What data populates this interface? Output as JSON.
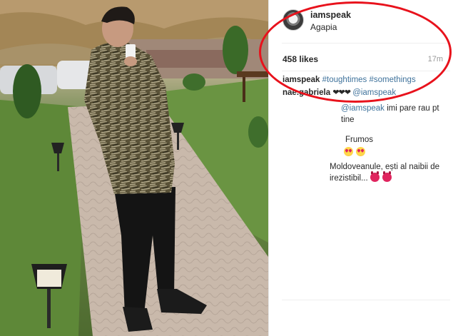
{
  "post": {
    "username": "iamspeak",
    "location": "Agapia",
    "likes": "458 likes",
    "time": "17m"
  },
  "comments": [
    {
      "user": "iamspeak",
      "text": "",
      "tags": [
        "#toughtimes",
        "#somethings"
      ]
    },
    {
      "user": "nae.gabriela",
      "hearts": "❤❤❤",
      "tag": "@iamspeak"
    },
    {
      "tag": "@iamspeak",
      "text": "imi pare rau pt tine"
    },
    {
      "text": "Frumos"
    },
    {
      "emoji": [
        "heart-eyes",
        "heart-eyes"
      ]
    },
    {
      "text": "Moldoveanule, ești al naibii de irezistibil...",
      "emoji": [
        "devil",
        "devil"
      ]
    }
  ],
  "colors": {
    "annotation": "#e8121c",
    "hashtag": "#3f729b",
    "text": "#262626",
    "muted": "#999999"
  }
}
